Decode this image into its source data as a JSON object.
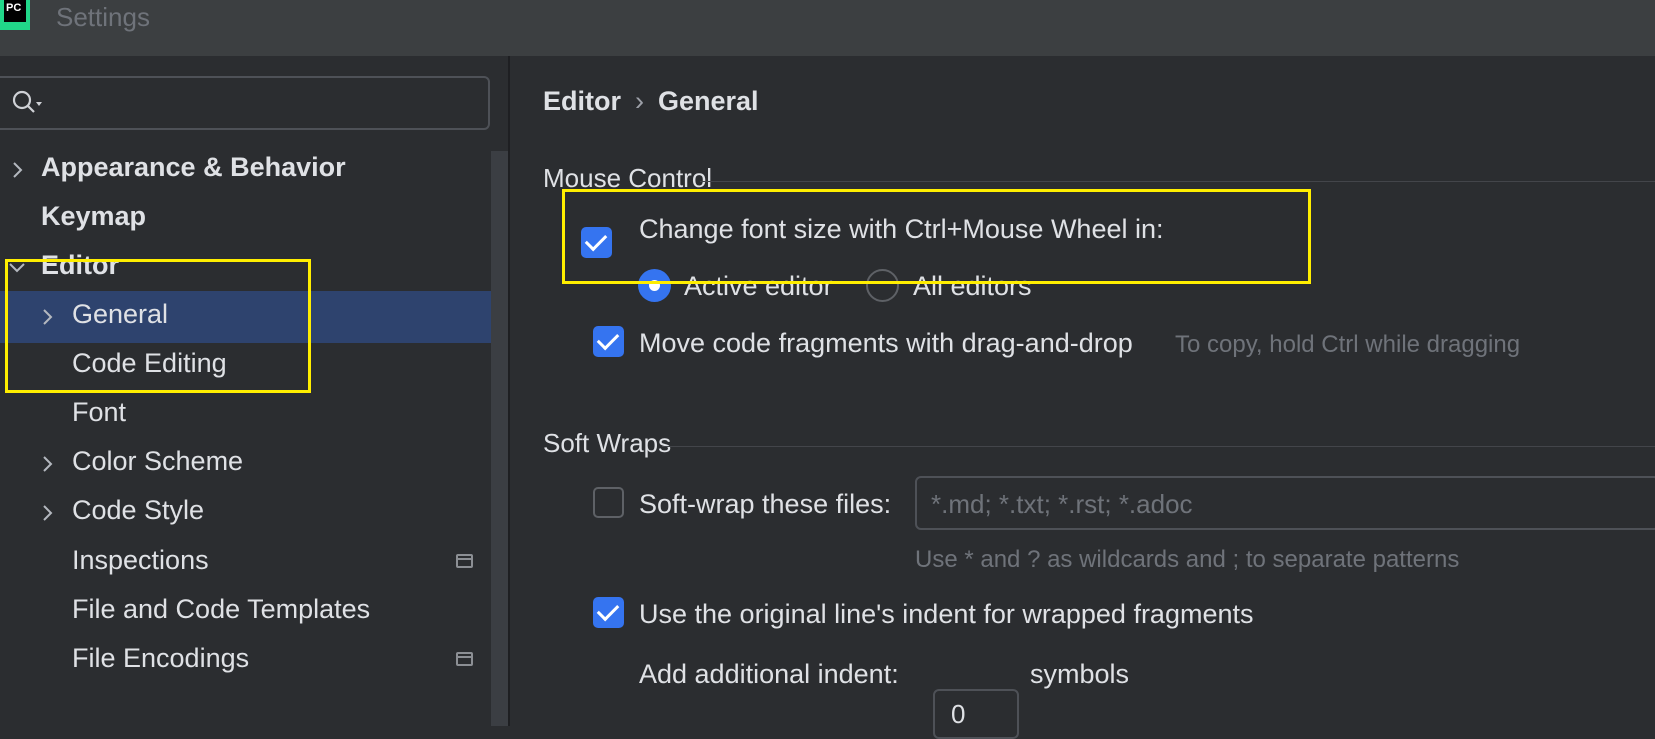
{
  "window": {
    "title": "Settings",
    "app_icon_text": "PC"
  },
  "search": {
    "placeholder": "",
    "value": ""
  },
  "sidebar": {
    "items": [
      {
        "label": "Appearance & Behavior"
      },
      {
        "label": "Keymap"
      },
      {
        "label": "Editor"
      },
      {
        "label": "General"
      },
      {
        "label": "Code Editing"
      },
      {
        "label": "Font"
      },
      {
        "label": "Color Scheme"
      },
      {
        "label": "Code Style"
      },
      {
        "label": "Inspections"
      },
      {
        "label": "File and Code Templates"
      },
      {
        "label": "File Encodings"
      }
    ],
    "selected": "General"
  },
  "breadcrumb": {
    "parent": "Editor",
    "current": "General"
  },
  "mouse_control": {
    "title": "Mouse Control",
    "change_font_size": {
      "label": "Change font size with Ctrl+Mouse Wheel in:",
      "checked": true
    },
    "radio_active_editor": {
      "label": "Active editor",
      "selected": true
    },
    "radio_all_editors": {
      "label": "All editors",
      "selected": false
    },
    "move_fragments": {
      "label": "Move code fragments with drag-and-drop",
      "checked": true,
      "hint": "To copy, hold Ctrl while dragging"
    }
  },
  "soft_wraps": {
    "title": "Soft Wraps",
    "soft_wrap_files": {
      "label": "Soft-wrap these files:",
      "checked": false,
      "placeholder": "*.md; *.txt; *.rst; *.adoc",
      "hint": "Use * and ? as wildcards and ; to separate patterns"
    },
    "original_indent": {
      "label": "Use the original line's indent for wrapped fragments",
      "checked": true
    },
    "additional_indent": {
      "label": "Add additional indent:",
      "value": "0",
      "unit": "symbols"
    }
  },
  "colors": {
    "accent": "#3574f0",
    "selection": "#2e436e",
    "highlight_box": "#ffee00",
    "background": "#2b2d30"
  }
}
